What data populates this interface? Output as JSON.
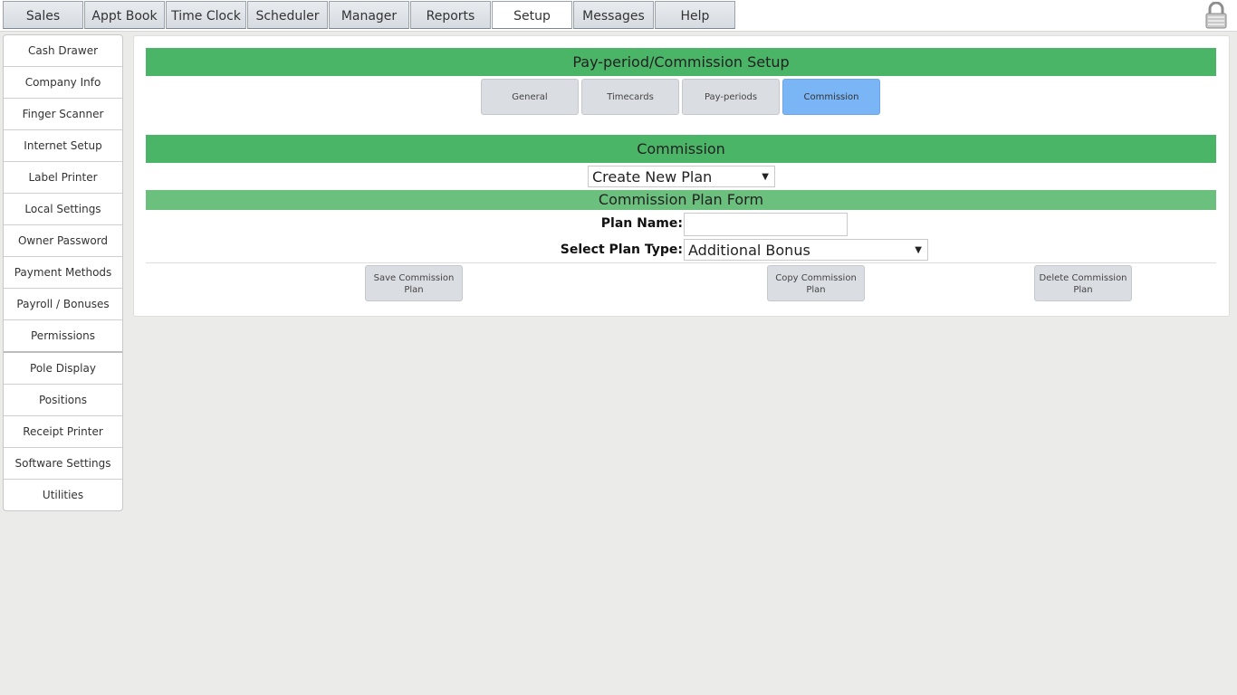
{
  "nav": {
    "tabs": [
      {
        "label": "Sales"
      },
      {
        "label": "Appt Book"
      },
      {
        "label": "Time Clock"
      },
      {
        "label": "Scheduler"
      },
      {
        "label": "Manager"
      },
      {
        "label": "Reports"
      },
      {
        "label": "Setup"
      },
      {
        "label": "Messages"
      },
      {
        "label": "Help"
      }
    ],
    "active_tab": "Setup",
    "lock_icon": "lock-icon"
  },
  "sidebar": {
    "items": [
      {
        "label": "Cash Drawer"
      },
      {
        "label": "Company Info"
      },
      {
        "label": "Finger Scanner"
      },
      {
        "label": "Internet Setup"
      },
      {
        "label": "Label Printer"
      },
      {
        "label": "Local Settings"
      },
      {
        "label": "Owner Password"
      },
      {
        "label": "Payment Methods"
      },
      {
        "label": "Payroll / Bonuses"
      },
      {
        "label": "Permissions"
      },
      {
        "label": "Pole Display"
      },
      {
        "label": "Positions"
      },
      {
        "label": "Receipt Printer"
      },
      {
        "label": "Software Settings"
      },
      {
        "label": "Utilities"
      }
    ]
  },
  "main": {
    "title": "Pay-period/Commission Setup",
    "subtabs": [
      {
        "label": "General"
      },
      {
        "label": "Timecards"
      },
      {
        "label": "Pay-periods"
      },
      {
        "label": "Commission"
      }
    ],
    "active_subtab": "Commission",
    "section_title": "Commission",
    "plan_select_value": "Create New Plan",
    "form_title": "Commission Plan Form",
    "plan_name_label": "Plan Name:",
    "plan_name_value": "",
    "plan_type_label": "Select Plan Type:",
    "plan_type_value": "Additional Bonus",
    "buttons": {
      "save": "Save Commission Plan",
      "copy": "Copy Commission Plan",
      "delete": "Delete Commission Plan"
    }
  },
  "colors": {
    "header_green": "#4bb567",
    "form_green": "#6cc07e",
    "active_subtab": "#7ab5f5"
  }
}
